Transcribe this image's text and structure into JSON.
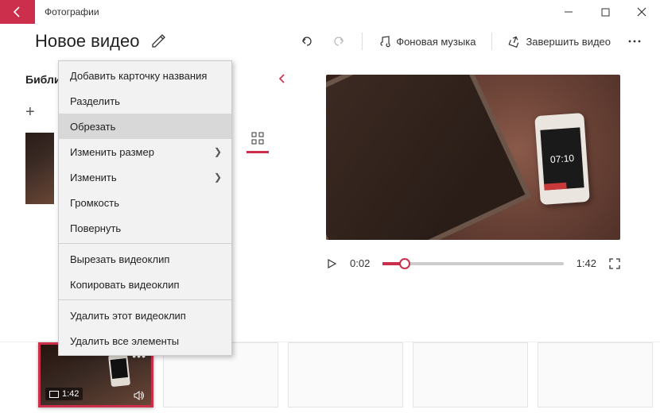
{
  "titlebar": {
    "app_name": "Фотографии"
  },
  "toolbar": {
    "project_title": "Новое видео",
    "bg_music": "Фоновая музыка",
    "finish": "Завершить видео"
  },
  "left": {
    "library_label": "Библи",
    "add_label": "+"
  },
  "context_menu": {
    "items": [
      {
        "label": "Добавить карточку названия",
        "submenu": false
      },
      {
        "label": "Разделить",
        "submenu": false
      },
      {
        "label": "Обрезать",
        "submenu": false,
        "hover": true
      },
      {
        "label": "Изменить размер",
        "submenu": true
      },
      {
        "label": "Изменить",
        "submenu": true
      },
      {
        "label": "Громкость",
        "submenu": false
      },
      {
        "label": "Повернуть",
        "submenu": false
      }
    ],
    "group2": [
      {
        "label": "Вырезать видеоклип"
      },
      {
        "label": "Копировать видеоклип"
      }
    ],
    "group3": [
      {
        "label": "Удалить этот видеоклип"
      },
      {
        "label": "Удалить все элементы"
      }
    ]
  },
  "player": {
    "current": "0:02",
    "total": "1:42",
    "phone_time": "07:10"
  },
  "storyboard": {
    "clip_duration": "1:42"
  },
  "colors": {
    "accent": "#cc2f4b"
  }
}
